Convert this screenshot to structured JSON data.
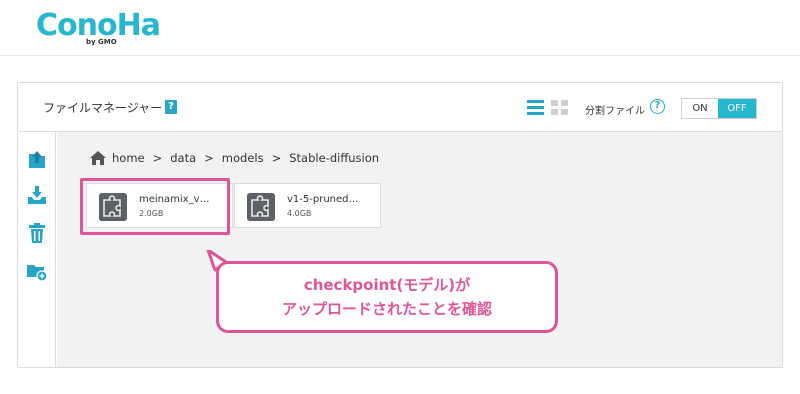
{
  "header": {
    "logo_text": "ConoHa",
    "logo_sub": "by GMO"
  },
  "panel": {
    "title": "ファイルマネージャー",
    "help_label": "?",
    "split_label": "分割ファイル",
    "split_help": "?",
    "toggle": {
      "on_label": "ON",
      "off_label": "OFF",
      "selected": "OFF"
    }
  },
  "sidebar": {
    "icons": [
      "upload-icon",
      "download-icon",
      "trash-icon",
      "add-folder-icon"
    ]
  },
  "breadcrumb": {
    "items": [
      "home",
      "data",
      "models",
      "Stable-diffusion"
    ],
    "separator": ">"
  },
  "files": [
    {
      "name": "meinamix_v…",
      "size": "2.0GB",
      "icon": "puzzle-icon"
    },
    {
      "name": "v1-5-pruned…",
      "size": "4.0GB",
      "icon": "puzzle-icon"
    }
  ],
  "annotation": {
    "line1": "checkpoint(モデル)が",
    "line2": "アップロードされたことを確認"
  },
  "colors": {
    "brand": "#26b7ce",
    "accent": "#26a5c9",
    "annotation": "#e0549a",
    "icon_dark": "#5b6166"
  }
}
